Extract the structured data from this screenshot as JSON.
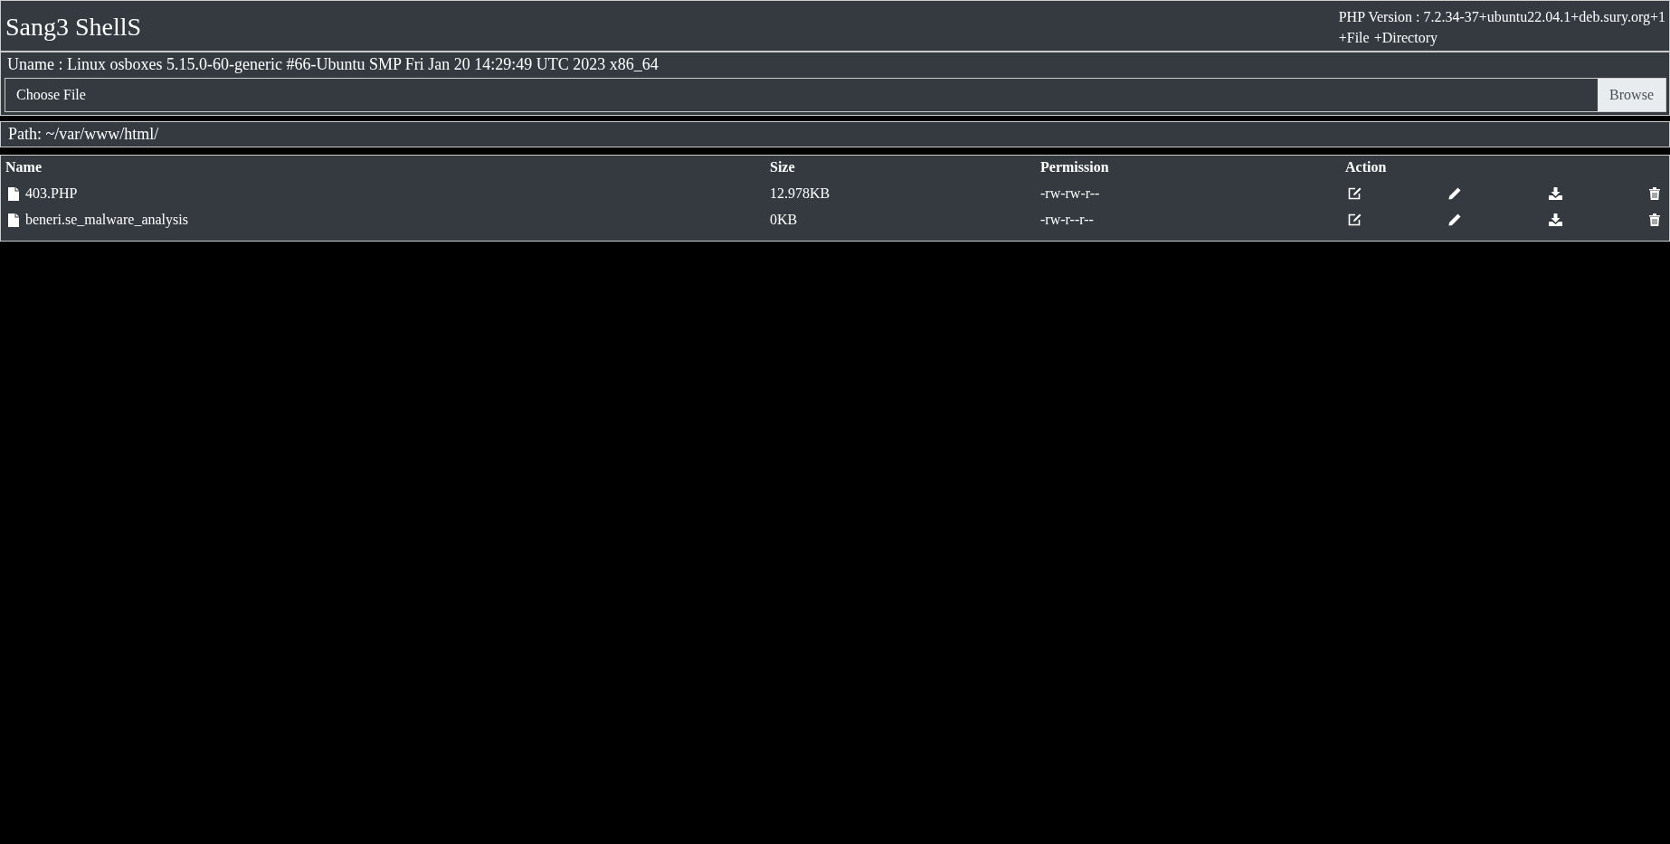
{
  "header": {
    "title": "Sang3 ShellS",
    "php_version": "PHP Version : 7.2.34-37+ubuntu22.04.1+deb.sury.org+1",
    "links": [
      "+File",
      "+Directory"
    ]
  },
  "uname": "Uname : Linux osboxes 5.15.0-60-generic #66-Ubuntu SMP Fri Jan 20 14:29:49 UTC 2023 x86_64",
  "upload": {
    "placeholder": "Choose File",
    "button": "Browse"
  },
  "path": "Path: ~/var/www/html/",
  "table": {
    "columns": [
      "Name",
      "Size",
      "Permission",
      "Action"
    ],
    "rows": [
      {
        "name": "403.PHP",
        "size": "12.978KB",
        "permission": "-rw-rw-r--"
      },
      {
        "name": "beneri.se_malware_analysis",
        "size": "0KB",
        "permission": "-rw-r--r--"
      }
    ]
  }
}
